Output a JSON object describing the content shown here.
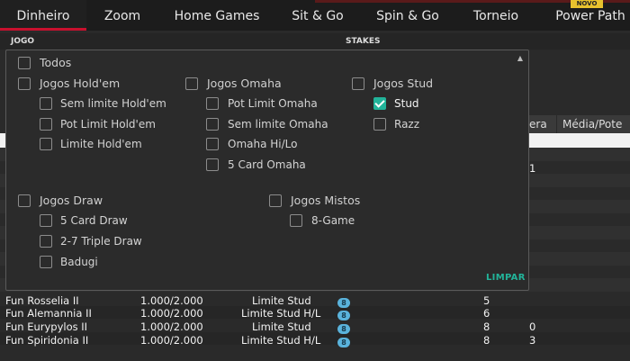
{
  "tabs": [
    "Dinheiro",
    "Zoom",
    "Home Games",
    "Sit & Go",
    "Spin & Go",
    "Torneio",
    "Power Path"
  ],
  "novo_badge": "NOVO",
  "filter": {
    "jogo": "JOGO",
    "stakes": "STAKES"
  },
  "table": {
    "headers": {
      "espera": "era",
      "media_pote": "Média/Pote"
    },
    "partial_values": [
      "1"
    ],
    "rows": [
      {
        "name": "Fun Rosselia II",
        "stakes": "1.000/2.000",
        "game": "Limite Stud",
        "icon": "8",
        "players": "5",
        "wait": ""
      },
      {
        "name": "Fun Alemannia II",
        "stakes": "1.000/2.000",
        "game": "Limite Stud H/L",
        "icon": "8",
        "players": "6",
        "wait": ""
      },
      {
        "name": "Fun Eurypylos II",
        "stakes": "1.000/2.000",
        "game": "Limite Stud",
        "icon": "8",
        "players": "8",
        "wait": "0"
      },
      {
        "name": "Fun Spiridonia II",
        "stakes": "1.000/2.000",
        "game": "Limite Stud H/L",
        "icon": "8",
        "players": "8",
        "wait": "3"
      }
    ]
  },
  "panel": {
    "todos": "Todos",
    "holdem": {
      "title": "Jogos Hold'em",
      "items": [
        "Sem limite Hold'em",
        "Pot Limit Hold'em",
        "Limite Hold'em"
      ]
    },
    "omaha": {
      "title": "Jogos Omaha",
      "items": [
        "Pot Limit Omaha",
        "Sem limite Omaha",
        "Omaha Hi/Lo",
        "5 Card Omaha"
      ]
    },
    "stud": {
      "title": "Jogos Stud",
      "items": [
        "Stud",
        "Razz"
      ]
    },
    "draw": {
      "title": "Jogos Draw",
      "items": [
        "5 Card Draw",
        "2-7 Triple Draw",
        "Badugi"
      ]
    },
    "mixed": {
      "title": "Jogos Mistos",
      "items": [
        "8-Game"
      ]
    },
    "clear": "LIMPAR"
  },
  "colors": {
    "accent": "#22b49a",
    "active_tab": "#c8102e",
    "badge": "#e8c22e"
  }
}
